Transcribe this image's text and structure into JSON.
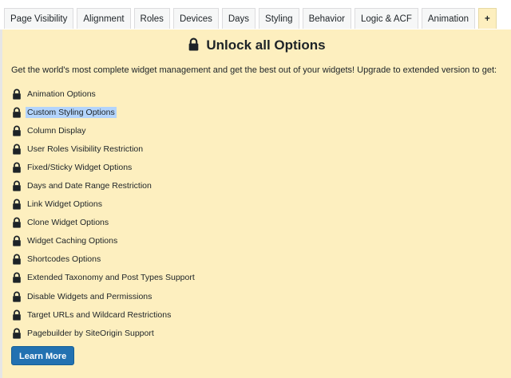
{
  "tabs": [
    {
      "label": "Page Visibility"
    },
    {
      "label": "Alignment"
    },
    {
      "label": "Roles"
    },
    {
      "label": "Devices"
    },
    {
      "label": "Days"
    },
    {
      "label": "Styling"
    },
    {
      "label": "Behavior"
    },
    {
      "label": "Logic & ACF"
    },
    {
      "label": "Animation"
    },
    {
      "label": "+"
    }
  ],
  "active_tab": "+",
  "panel": {
    "title": "Unlock all Options",
    "intro": "Get the world's most complete widget management and get the best out of your widgets! Upgrade to extended version to get:",
    "features": [
      {
        "label": "Animation Options"
      },
      {
        "label": "Custom Styling Options"
      },
      {
        "label": "Column Display"
      },
      {
        "label": "User Roles Visibility Restriction"
      },
      {
        "label": "Fixed/Sticky Widget Options"
      },
      {
        "label": "Days and Date Range Restriction"
      },
      {
        "label": "Link Widget Options"
      },
      {
        "label": "Clone Widget Options"
      },
      {
        "label": "Widget Caching Options"
      },
      {
        "label": "Shortcodes Options"
      },
      {
        "label": "Extended Taxonomy and Post Types Support"
      },
      {
        "label": "Disable Widgets and Permissions"
      },
      {
        "label": "Target URLs and Wildcard Restrictions"
      },
      {
        "label": "Pagebuilder by SiteOrigin Support"
      }
    ],
    "selected_feature": "Custom Styling Options",
    "learn_more_label": "Learn More"
  },
  "icons": {
    "feature_icon": "lock-icon",
    "title_icon": "lock-icon"
  },
  "colors": {
    "panel_bg": "#fdefbf",
    "button_bg": "#2271b1",
    "selection": "#b3d4fc"
  }
}
